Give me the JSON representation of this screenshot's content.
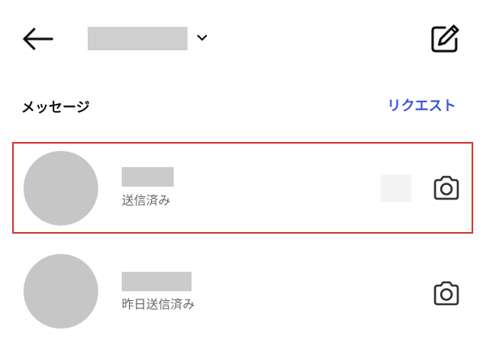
{
  "header": {
    "back_icon": "arrow-left-icon",
    "account_dropdown_icon": "chevron-down-icon",
    "compose_icon": "compose-edit-icon"
  },
  "section": {
    "title": "メッセージ",
    "requests_label": "リクエスト",
    "requests_color": "#3b52d9"
  },
  "conversations": [
    {
      "status": "送信済み",
      "action_icon": "camera-icon",
      "highlighted": true,
      "highlight_color": "#d33a3a"
    },
    {
      "status": "昨日送信済み",
      "action_icon": "camera-icon",
      "highlighted": false
    }
  ]
}
